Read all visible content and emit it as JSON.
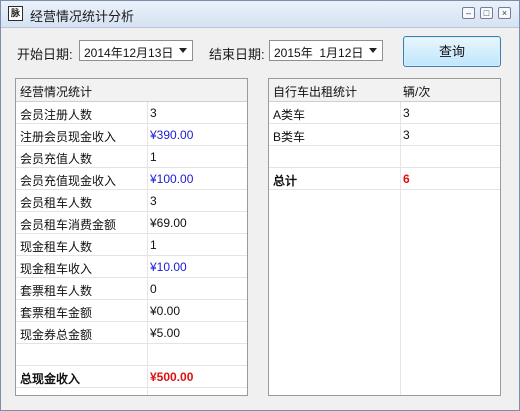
{
  "window": {
    "title": "经营情况统计分析",
    "icon_text": "脉",
    "controls": [
      "minimize-icon",
      "maximize-icon",
      "close-icon"
    ]
  },
  "filters": {
    "start_label": "开始日期:",
    "start_value": "2014年12月13日",
    "end_label": "结束日期:",
    "end_value": "2015年  1月12日",
    "query_button": "查询"
  },
  "left_table": {
    "headers": [
      "经营情况统计",
      ""
    ],
    "rows": [
      {
        "name": "会员注册人数",
        "value": "3",
        "style": "normal"
      },
      {
        "name": "注册会员现金收入",
        "value": "¥390.00",
        "style": "blue"
      },
      {
        "name": "会员充值人数",
        "value": "1",
        "style": "normal"
      },
      {
        "name": "会员充值现金收入",
        "value": "¥100.00",
        "style": "blue"
      },
      {
        "name": "会员租车人数",
        "value": "3",
        "style": "normal"
      },
      {
        "name": "会员租车消费金额",
        "value": "¥69.00",
        "style": "normal"
      },
      {
        "name": "现金租车人数",
        "value": "1",
        "style": "normal"
      },
      {
        "name": "现金租车收入",
        "value": "¥10.00",
        "style": "blue"
      },
      {
        "name": "套票租车人数",
        "value": "0",
        "style": "normal"
      },
      {
        "name": "套票租车金额",
        "value": "¥0.00",
        "style": "normal"
      },
      {
        "name": "现金券总金额",
        "value": "¥5.00",
        "style": "normal"
      },
      {
        "name": "",
        "value": "",
        "style": "normal"
      },
      {
        "name": "总现金收入",
        "value": "¥500.00",
        "style": "total"
      }
    ]
  },
  "right_table": {
    "headers": [
      "自行车出租统计",
      "辆/次"
    ],
    "rows": [
      {
        "name": "A类车",
        "value": "3",
        "style": "normal"
      },
      {
        "name": "B类车",
        "value": "3",
        "style": "normal"
      },
      {
        "name": "",
        "value": "",
        "style": "normal"
      },
      {
        "name": "总计",
        "value": "6",
        "style": "total"
      }
    ]
  }
}
